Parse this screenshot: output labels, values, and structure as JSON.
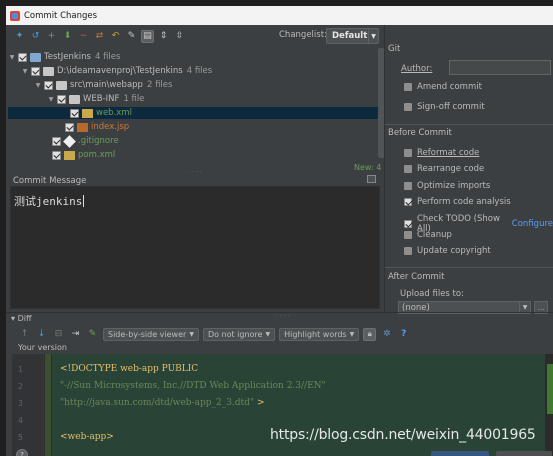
{
  "window": {
    "title": "Commit Changes",
    "close_glyph": "✕"
  },
  "toolbar": {
    "icons": [
      "refresh-icon",
      "rollback-icon",
      "add-icon",
      "update-icon",
      "delete-icon",
      "diff-icon",
      "undo-icon",
      "edit-icon",
      "group-icon",
      "expand-all-icon",
      "collapse-all-icon"
    ],
    "changelist_label": "Changelist:",
    "changelist_value": "Default"
  },
  "tree": {
    "rows": [
      {
        "text": "TestJenkins",
        "count": "4 files",
        "level": 0,
        "icon": "module",
        "color": "normal"
      },
      {
        "text": "D:\\ideamavenproj\\TestJenkins",
        "count": "4 files",
        "level": 1,
        "icon": "folder",
        "color": "normal"
      },
      {
        "text": "src\\main\\webapp",
        "count": "2 files",
        "level": 2,
        "icon": "folder",
        "color": "normal"
      },
      {
        "text": "WEB-INF",
        "count": "1 file",
        "level": 3,
        "icon": "folder",
        "color": "normal"
      },
      {
        "text": "web.xml",
        "count": "",
        "level": 4,
        "icon": "xml",
        "color": "green",
        "selected": true
      },
      {
        "text": "index.jsp",
        "count": "",
        "level": 3,
        "icon": "jsp",
        "color": "orange"
      },
      {
        "text": ".gitignore",
        "count": "",
        "level": 2,
        "icon": "git",
        "color": "green"
      },
      {
        "text": "pom.xml",
        "count": "",
        "level": 2,
        "icon": "xml",
        "color": "green"
      }
    ],
    "new_count": "New: 4"
  },
  "commit_message": {
    "label": "Commit Message",
    "value": "测试jenkins"
  },
  "git_panel": {
    "title": "Git",
    "author_label": "Author:",
    "author_value": "",
    "amend_commit": "Amend commit",
    "sign_off_commit": "Sign-off commit"
  },
  "before_commit": {
    "title": "Before Commit",
    "options": [
      {
        "label": "Reformat code",
        "checked": false
      },
      {
        "label": "Rearrange code",
        "checked": false
      },
      {
        "label": "Optimize imports",
        "checked": false
      },
      {
        "label": "Perform code analysis",
        "checked": true
      },
      {
        "label": "Check TODO (Show All)",
        "checked": true
      },
      {
        "label": "Cleanup",
        "checked": false
      },
      {
        "label": "Update copyright",
        "checked": false
      }
    ],
    "configure_link": "Configure"
  },
  "after_commit": {
    "title": "After Commit",
    "upload_label": "Upload files to:",
    "upload_value": "(none)",
    "more": "..."
  },
  "diff": {
    "label": "Diff",
    "viewer": "Side-by-side viewer",
    "whitespace": "Do not ignore",
    "highlight": "Highlight words",
    "help": "?",
    "your_version": "Your version",
    "lines": [
      {
        "n": "1",
        "html": "<span class='kw'>&lt;!DOCTYPE</span> <span class='kw'>web-app PUBLIC</span>"
      },
      {
        "n": "2",
        "html": "<span class='st'>\"-//Sun Microsystems, Inc.//DTD Web Application 2.3//EN\"</span>"
      },
      {
        "n": "3",
        "html": "<span class='st'>\"http://java.sun.com/dtd/web-app_2_3.dtd\"</span> <span class='kw'>&gt;</span>"
      },
      {
        "n": "4",
        "html": ""
      },
      {
        "n": "5",
        "html": "<span class='kw'>&lt;web-app&gt;</span>"
      }
    ]
  },
  "watermark": "https://blog.csdn.net/weixin_44001965",
  "colors": {
    "background": "#3c3f41",
    "editor": "#2b2b2b",
    "inserted": "#294436",
    "link": "#589df6"
  }
}
